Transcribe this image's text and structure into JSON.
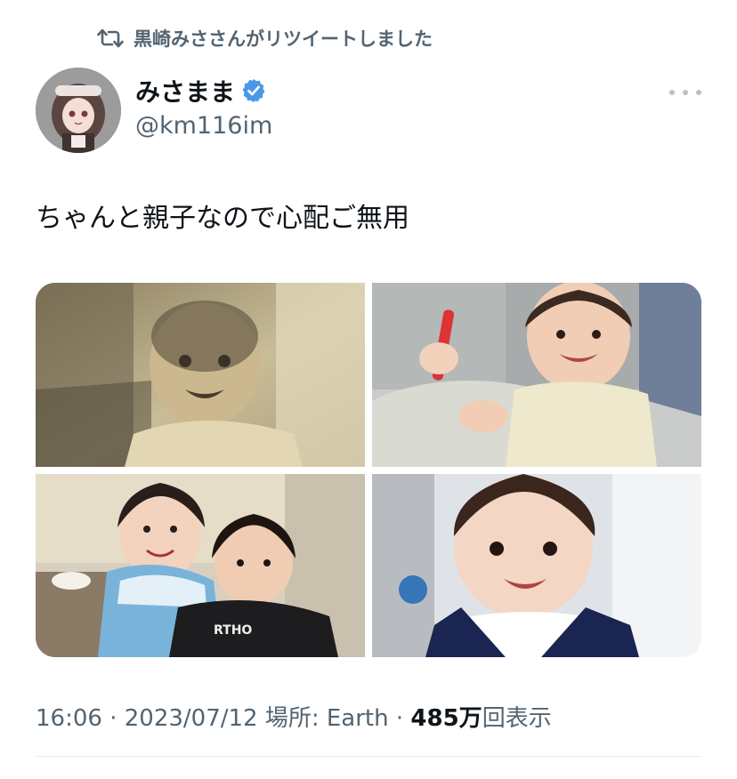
{
  "retweet": {
    "icon": "retweet-icon",
    "text": "黒崎みささんがリツイートしました"
  },
  "tweet": {
    "author": {
      "display_name": "みさまま",
      "handle": "@km116im",
      "verified": true,
      "verified_color": "#4a99e9"
    },
    "text": "ちゃんと親子なので心配ご無用",
    "media": [
      {
        "label": "sepia-baby-photo"
      },
      {
        "label": "baby-on-sofa-photo"
      },
      {
        "label": "two-children-photo"
      },
      {
        "label": "baby-sailor-collar-photo"
      }
    ],
    "meta": {
      "time": "16:06",
      "separator1": " · ",
      "date": "2023/07/12",
      "location": " 場所: Earth",
      "separator2": " · ",
      "views_count": "485万",
      "views_label": "回表示"
    }
  },
  "colors": {
    "secondary_text": "#536471",
    "primary_text": "#0f1419",
    "divider": "#e6ecf0"
  }
}
